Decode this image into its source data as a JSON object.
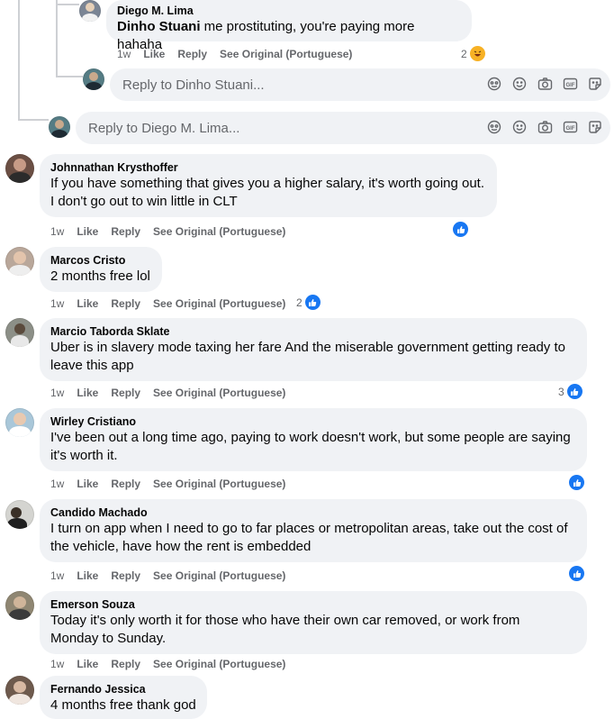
{
  "nested": {
    "comment": {
      "author": "Diego M. Lima",
      "mention": "Dinho Stuani",
      "text": " me prostituting, you're paying more hahaha",
      "time": "1w",
      "like": "Like",
      "reply": "Reply",
      "see_original": "See Original (Portuguese)",
      "reaction_count": "2"
    },
    "reply_box_placeholder": "Reply to Dinho Stuani..."
  },
  "reply_box_placeholder": "Reply to Diego M. Lima...",
  "comments": [
    {
      "author": "Johnnathan Krysthoffer",
      "lines": [
        "If you have something that gives you a higher salary, it's worth going out.",
        "I don't go out to win little in CLT"
      ],
      "time": "1w",
      "like": "Like",
      "reply": "Reply",
      "see_original": "See Original (Portuguese)",
      "reaction_count": ""
    },
    {
      "author": "Marcos Cristo",
      "lines": [
        "2 months free lol"
      ],
      "time": "1w",
      "like": "Like",
      "reply": "Reply",
      "see_original": "See Original (Portuguese)",
      "reaction_count": "2"
    },
    {
      "author": "Marcio Taborda Sklate",
      "lines": [
        "Uber is in slavery mode taxing her fare And the miserable government getting ready to",
        "leave this app"
      ],
      "time": "1w",
      "like": "Like",
      "reply": "Reply",
      "see_original": "See Original (Portuguese)",
      "reaction_count": "3"
    },
    {
      "author": "Wirley Cristiano",
      "lines": [
        "I've been out a long time ago, paying to work doesn't work, but some people are saying",
        "it's worth it."
      ],
      "time": "1w",
      "like": "Like",
      "reply": "Reply",
      "see_original": "See Original (Portuguese)",
      "reaction_count": ""
    },
    {
      "author": "Candido Machado",
      "lines": [
        "I turn on app when I need to go to far places or metropolitan areas, take out the cost of",
        "the vehicle, have how the rent is embedded"
      ],
      "time": "1w",
      "like": "Like",
      "reply": "Reply",
      "see_original": "See Original (Portuguese)",
      "reaction_count": ""
    },
    {
      "author": "Emerson Souza",
      "lines": [
        "Today it's only worth it for those who have their own car removed, or work from",
        "Monday to Sunday."
      ],
      "time": "1w",
      "like": "Like",
      "reply": "Reply",
      "see_original": "See Original (Portuguese)",
      "reaction_count": ""
    },
    {
      "author": "Fernando Jessica",
      "lines": [
        "4 months free thank god"
      ]
    }
  ],
  "colors": {
    "like_blue": "#1877f2",
    "bubble_bg": "#f0f2f5",
    "meta_gray": "#65676b"
  },
  "icons": [
    "emoji-sticker-icon",
    "smiley-icon",
    "camera-icon",
    "gif-icon",
    "sticker-icon",
    "like-reaction-icon",
    "haha-reaction-icon"
  ]
}
